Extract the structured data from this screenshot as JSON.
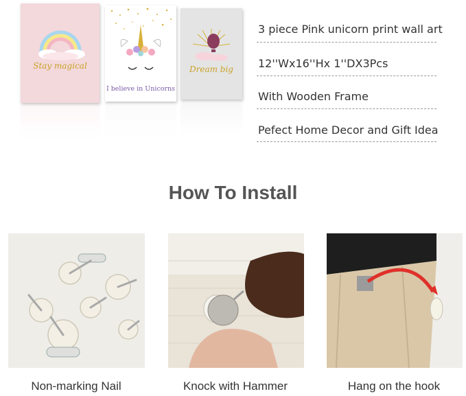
{
  "product": {
    "panels": [
      {
        "text": "Stay magical",
        "bg": "#f3d8dc"
      },
      {
        "text": "I believe in Unicorns",
        "bg": "#ffffff"
      },
      {
        "text": "Dream big",
        "bg": "#e4e4e4"
      }
    ],
    "features": [
      "3 piece Pink unicorn print wall art",
      "12''Wx16''Hx 1''DX3Pcs",
      "With Wooden Frame",
      "Pefect Home Decor and Gift Idea"
    ]
  },
  "install": {
    "title": "How To Install",
    "steps": [
      {
        "caption": "Non-marking Nail"
      },
      {
        "caption": "Knock with Hammer"
      },
      {
        "caption": "Hang on the hook"
      }
    ]
  },
  "colors": {
    "pink_panel": "#f3d8dc",
    "gold": "#c9a227",
    "arrow_red": "#e0302a",
    "title_gray": "#555555"
  }
}
